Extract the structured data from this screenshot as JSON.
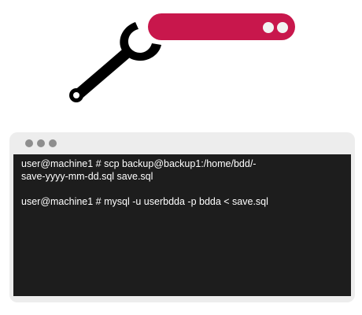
{
  "terminal": {
    "commands": [
      {
        "line1": "user@machine1 # scp backup@backup1:/home/bdd/-",
        "line2": "save-yyyy-mm-dd.sql save.sql"
      },
      {
        "line1": "user@machine1 # mysql -u userbdda -p bdda < save.sql"
      }
    ]
  },
  "colors": {
    "accent_bar": "#c8174c",
    "wrench": "#000000",
    "terminal_bg": "#1d1d1d",
    "window_frame": "#ededed"
  },
  "icons": [
    "wrench-icon",
    "toggle-pill-icon",
    "window-control-dots"
  ]
}
